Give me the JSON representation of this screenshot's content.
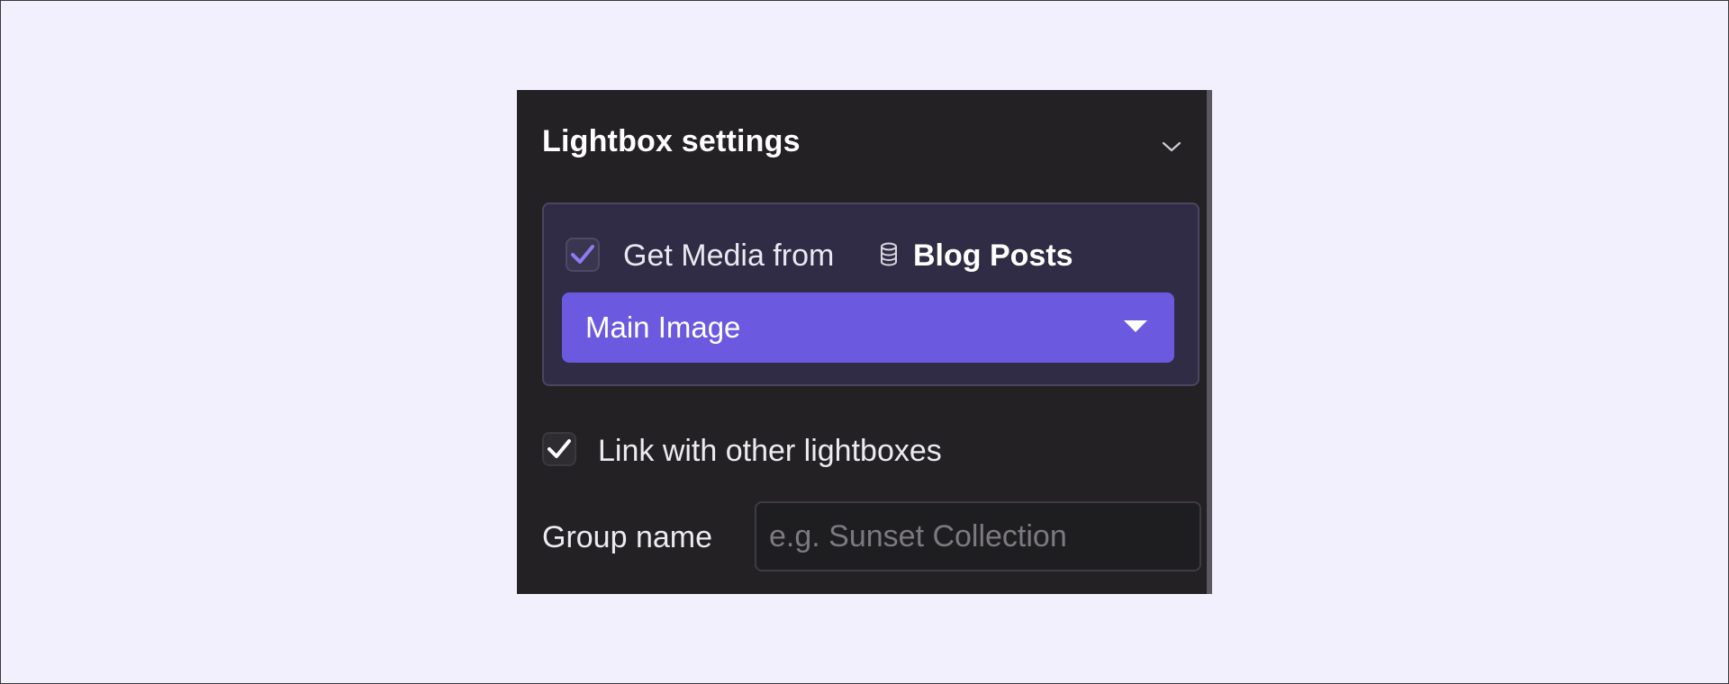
{
  "lightbox_settings": {
    "title": "Lightbox settings",
    "media_source": {
      "checked": true,
      "label": "Get Media from",
      "collection_icon": "database-icon",
      "collection_name": "Blog Posts",
      "selected_field": "Main Image"
    },
    "link_lightboxes": {
      "checked": true,
      "label": "Link with other lightboxes"
    },
    "group_name": {
      "label": "Group name",
      "value": "",
      "placeholder": "e.g. Sunset Collection"
    }
  },
  "colors": {
    "panel_background": "#232124",
    "card_background": "#302c45",
    "accent_purple": "#6b5ae0",
    "check_purple": "#8b7cf0",
    "page_background": "#f2f0fd"
  }
}
